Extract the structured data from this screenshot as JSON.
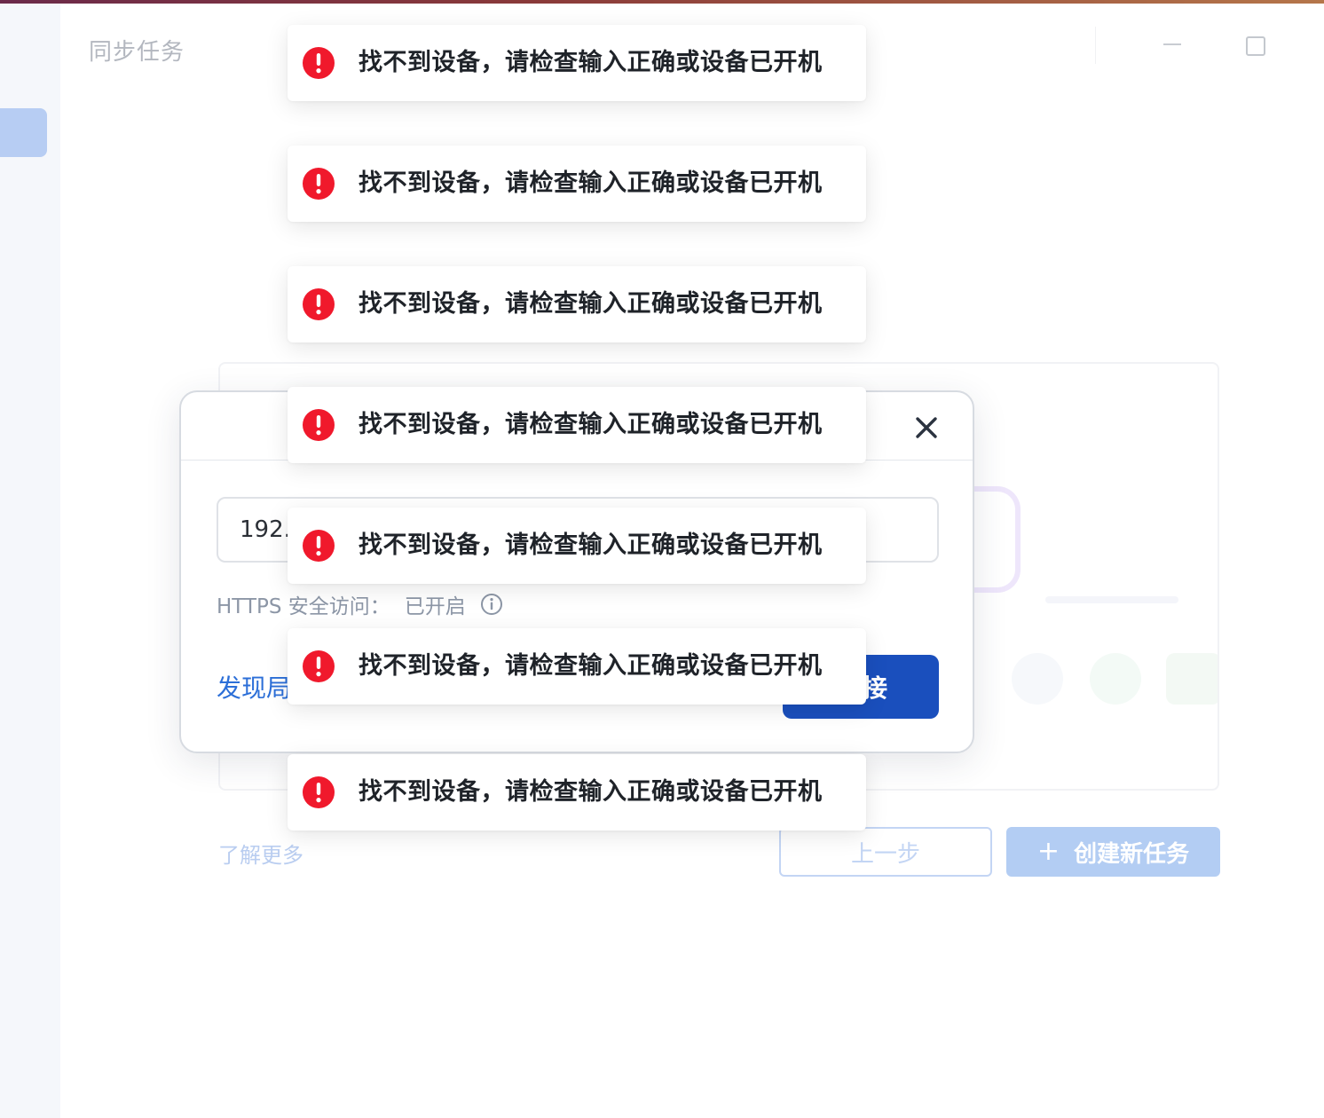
{
  "page": {
    "title": "同步任务"
  },
  "footer": {
    "learn_more": "了解更多",
    "prev_label": "上一步",
    "create_icon": "+",
    "create_label": "创建新任务"
  },
  "dialog": {
    "address_value": "192.",
    "https_label": "HTTPS 安全访问：",
    "https_value": "已开启",
    "discover_label": "发现局",
    "connect_label": "接"
  },
  "toasts": [
    {
      "type": "error",
      "icon": "error-circle-icon",
      "message": "找不到设备，请检查输入正确或设备已开机"
    },
    {
      "type": "error",
      "icon": "error-circle-icon",
      "message": "找不到设备，请检查输入正确或设备已开机"
    },
    {
      "type": "error",
      "icon": "error-circle-icon",
      "message": "找不到设备，请检查输入正确或设备已开机"
    },
    {
      "type": "error",
      "icon": "error-circle-icon",
      "message": "找不到设备，请检查输入正确或设备已开机"
    },
    {
      "type": "error",
      "icon": "error-circle-icon",
      "message": "找不到设备，请检查输入正确或设备已开机"
    },
    {
      "type": "error",
      "icon": "error-circle-icon",
      "message": "找不到设备，请检查输入正确或设备已开机"
    },
    {
      "type": "error",
      "icon": "error-circle-icon",
      "message": "找不到设备，请检查输入正确或设备已开机"
    }
  ],
  "colors": {
    "primary": "#1a4fbd",
    "link": "#2c6fd8",
    "error": "#f0192c",
    "disabled_primary": "#b3cdf3"
  }
}
